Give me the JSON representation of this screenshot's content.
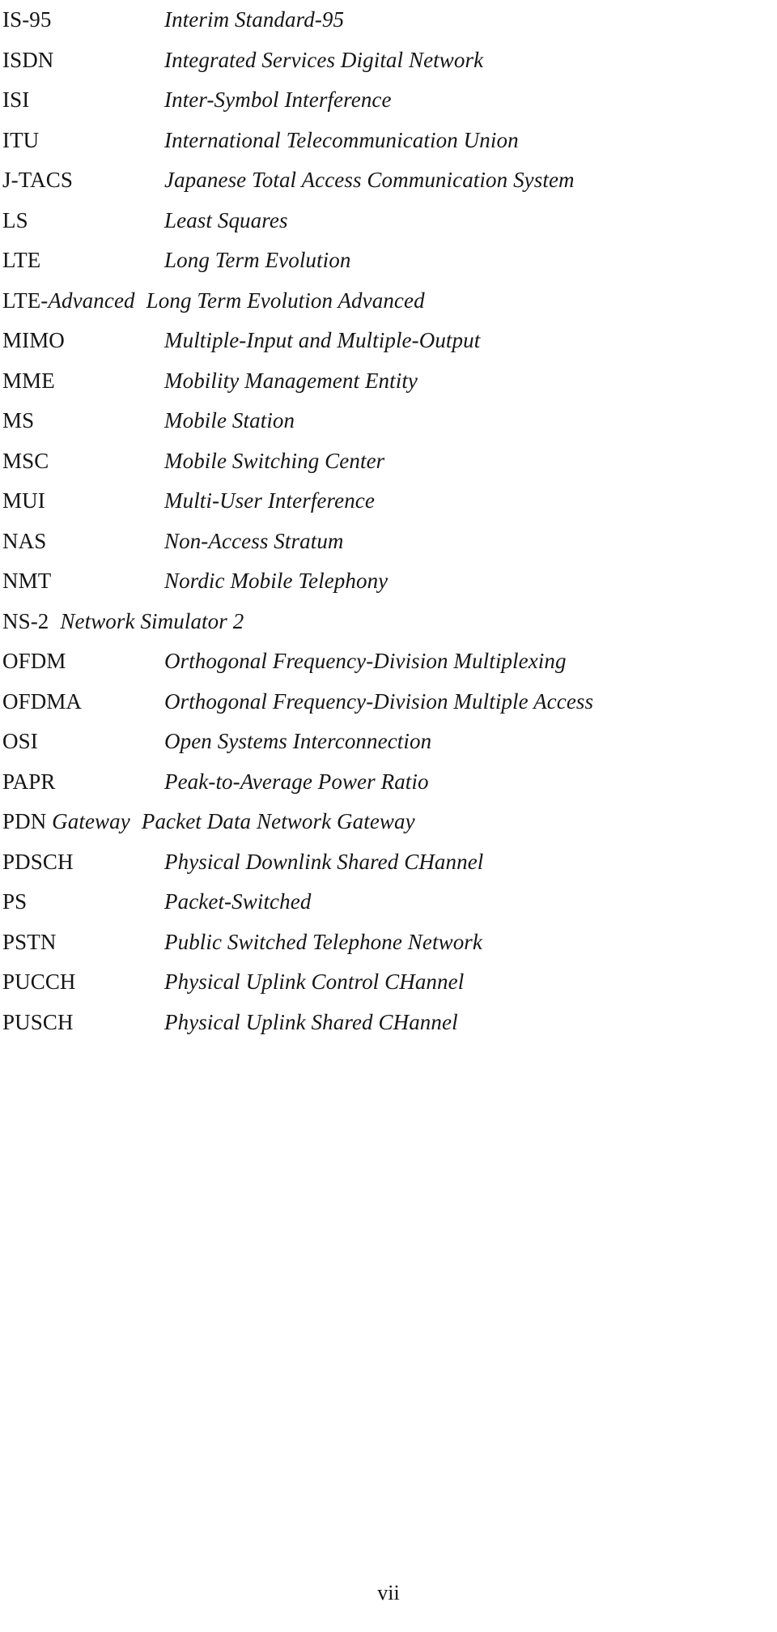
{
  "document": {
    "kind": "list-of-abbreviations",
    "page_number": "vii",
    "rows": [
      {
        "term": "IS-95",
        "term_italic_tail": "",
        "definition": "Interim Standard-95",
        "tight": false
      },
      {
        "term": "ISDN",
        "term_italic_tail": "",
        "definition": "Integrated Services Digital Network",
        "tight": false
      },
      {
        "term": "ISI",
        "term_italic_tail": "",
        "definition": "Inter-Symbol Interference",
        "tight": false
      },
      {
        "term": "ITU",
        "term_italic_tail": "",
        "definition": "International Telecommunication Union",
        "tight": false
      },
      {
        "term": "J-TACS",
        "term_italic_tail": "",
        "definition": "Japanese Total Access Communication System",
        "tight": false
      },
      {
        "term": "LS",
        "term_italic_tail": "",
        "definition": "Least Squares",
        "tight": false
      },
      {
        "term": "LTE",
        "term_italic_tail": "",
        "definition": "Long Term Evolution",
        "tight": false
      },
      {
        "term": "LTE-",
        "term_italic_tail": "Advanced",
        "definition": "Long Term Evolution Advanced",
        "tight": true
      },
      {
        "term": "MIMO",
        "term_italic_tail": "",
        "definition": "Multiple-Input and Multiple-Output",
        "tight": false
      },
      {
        "term": "MME",
        "term_italic_tail": "",
        "definition": "Mobility Management Entity",
        "tight": false
      },
      {
        "term": "MS",
        "term_italic_tail": "",
        "definition": "Mobile Station",
        "tight": false
      },
      {
        "term": "MSC",
        "term_italic_tail": "",
        "definition": "Mobile Switching Center",
        "tight": false
      },
      {
        "term": "MUI",
        "term_italic_tail": "",
        "definition": "Multi-User Interference",
        "tight": false
      },
      {
        "term": "NAS",
        "term_italic_tail": "",
        "definition": "Non-Access Stratum",
        "tight": false
      },
      {
        "term": "NMT",
        "term_italic_tail": "",
        "definition": "Nordic Mobile Telephony",
        "tight": false
      },
      {
        "term": "NS-2",
        "term_italic_tail": "",
        "definition": "Network Simulator 2",
        "tight": true
      },
      {
        "term": "OFDM",
        "term_italic_tail": "",
        "definition": "Orthogonal Frequency-Division Multiplexing",
        "tight": false
      },
      {
        "term": "OFDMA",
        "term_italic_tail": "",
        "definition": "Orthogonal Frequency-Division Multiple Access",
        "tight": false
      },
      {
        "term": "OSI",
        "term_italic_tail": "",
        "definition": "Open Systems Interconnection",
        "tight": false
      },
      {
        "term": "PAPR",
        "term_italic_tail": "",
        "definition": "Peak-to-Average Power Ratio",
        "tight": false
      },
      {
        "term": "PDN ",
        "term_italic_tail": "Gateway",
        "definition": "Packet Data Network Gateway",
        "tight": true
      },
      {
        "term": "PDSCH",
        "term_italic_tail": "",
        "definition": "Physical Downlink Shared CHannel",
        "tight": false
      },
      {
        "term": "PS",
        "term_italic_tail": "",
        "definition": "Packet-Switched",
        "tight": false
      },
      {
        "term": "PSTN",
        "term_italic_tail": "",
        "definition": "Public Switched Telephone Network",
        "tight": false
      },
      {
        "term": "PUCCH",
        "term_italic_tail": "",
        "definition": "Physical Uplink Control CHannel",
        "tight": false
      },
      {
        "term": "PUSCH",
        "term_italic_tail": "",
        "definition": "Physical Uplink Shared CHannel",
        "tight": false
      }
    ]
  }
}
